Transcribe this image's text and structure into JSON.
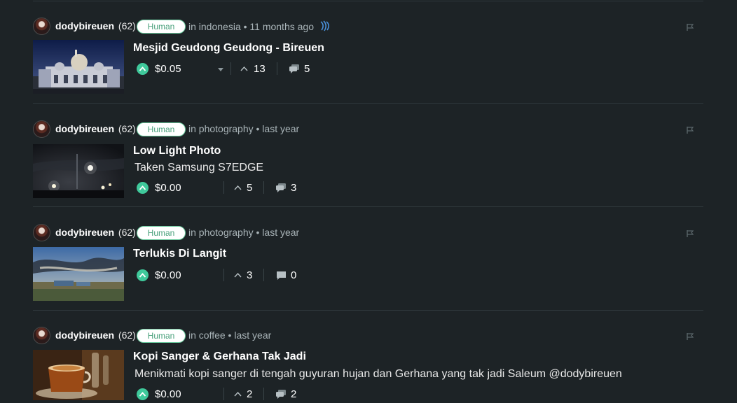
{
  "colors": {
    "background": "#1d2326",
    "divider": "#2f383c",
    "upvote_green": "#3fc99b",
    "badge_text": "#4aa17c",
    "meta_text": "#a9b4b8"
  },
  "posts": [
    {
      "author": "dodybireuen",
      "reputation": "(62)",
      "badge": "Human",
      "meta": "in indonesia • 11 months ago",
      "title": "Mesjid Geudong Geudong - Bireuen",
      "excerpt": "",
      "payout": "$0.05",
      "votes": "13",
      "comments": "5",
      "thumbnail_icon": "mosque-photo"
    },
    {
      "author": "dodybireuen",
      "reputation": "(62)",
      "badge": "Human",
      "meta": "in photography • last year",
      "title": "Low Light Photo",
      "excerpt": "Taken Samsung S7EDGE",
      "payout": "$0.00",
      "votes": "5",
      "comments": "3",
      "thumbnail_icon": "night-sky-photo"
    },
    {
      "author": "dodybireuen",
      "reputation": "(62)",
      "badge": "Human",
      "meta": "in photography • last year",
      "title": "Terlukis Di Langit",
      "excerpt": "",
      "payout": "$0.00",
      "votes": "3",
      "comments": "0",
      "thumbnail_icon": "sky-landscape-photo"
    },
    {
      "author": "dodybireuen",
      "reputation": "(62)",
      "badge": "Human",
      "meta": "in coffee • last year",
      "title": "Kopi Sanger & Gerhana Tak Jadi",
      "excerpt": "Menikmati kopi sanger di tengah guyuran hujan dan Gerhana yang tak jadi Saleum @dodybireuen",
      "payout": "$0.00",
      "votes": "2",
      "comments": "2",
      "thumbnail_icon": "coffee-cup-photo"
    }
  ]
}
